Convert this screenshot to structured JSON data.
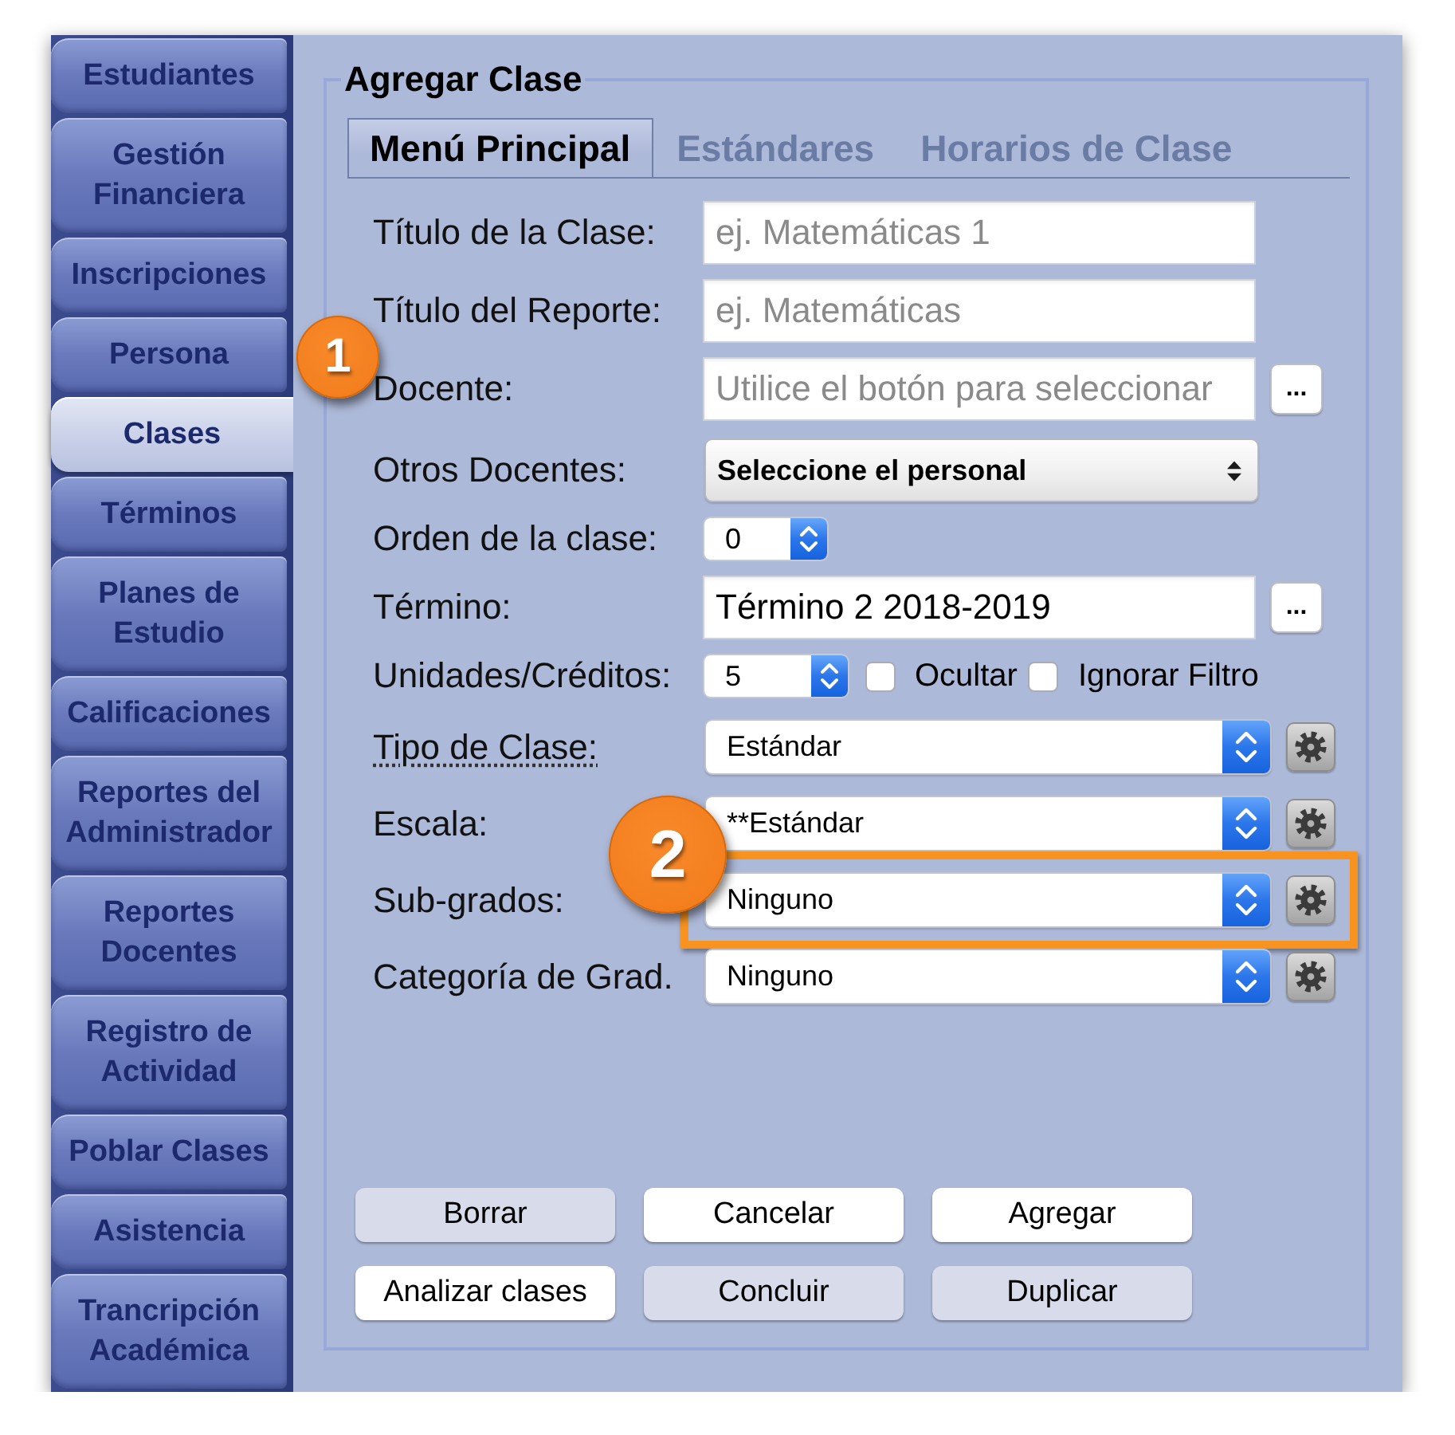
{
  "sidebar": {
    "items": [
      {
        "label": "Estudiantes",
        "selected": false
      },
      {
        "label": "Gestión Financiera",
        "selected": false
      },
      {
        "label": "Inscripciones",
        "selected": false
      },
      {
        "label": "Persona",
        "selected": false
      },
      {
        "label": "Clases",
        "selected": true
      },
      {
        "label": "Términos",
        "selected": false
      },
      {
        "label": "Planes de Estudio",
        "selected": false
      },
      {
        "label": "Calificaciones",
        "selected": false
      },
      {
        "label": "Reportes del Administrador",
        "selected": false
      },
      {
        "label": "Reportes Docentes",
        "selected": false
      },
      {
        "label": "Registro de Actividad",
        "selected": false
      },
      {
        "label": "Poblar Clases",
        "selected": false
      },
      {
        "label": "Asistencia",
        "selected": false
      },
      {
        "label": "Trancripción Académica",
        "selected": false
      }
    ]
  },
  "panel": {
    "title": "Agregar Clase"
  },
  "tabs": [
    {
      "label": "Menú Principal",
      "selected": true
    },
    {
      "label": "Estándares",
      "selected": false
    },
    {
      "label": "Horarios de Clase",
      "selected": false
    }
  ],
  "fields": [
    {
      "kind": "text",
      "label": "Título de la Clase:",
      "placeholder": "ej. Matemáticas 1",
      "linked": false,
      "highlighted": false
    },
    {
      "kind": "text",
      "label": "Título del Reporte:",
      "placeholder": "ej. Matemáticas",
      "linked": false,
      "highlighted": false
    },
    {
      "kind": "picker",
      "label": "Docente:",
      "placeholder": "Utilice el botón para seleccionar",
      "button": "...",
      "linked": false,
      "highlighted": false
    },
    {
      "kind": "popup",
      "label": "Otros Docentes:",
      "value": "Seleccione el personal",
      "linked": false,
      "highlighted": false
    },
    {
      "kind": "stepper",
      "label": "Orden de la clase:",
      "value": "0",
      "linked": false,
      "highlighted": false
    },
    {
      "kind": "picker",
      "label": "Término:",
      "value": "Término 2 2018-2019",
      "button": "...",
      "linked": false,
      "highlighted": false
    },
    {
      "kind": "stepper",
      "label": "Unidades/Créditos:",
      "value": "5",
      "checkboxes": [
        {
          "label": "Ocultar",
          "checked": false
        },
        {
          "label": "Ignorar Filtro",
          "checked": false
        }
      ],
      "linked": false,
      "highlighted": false
    },
    {
      "kind": "select",
      "label": "Tipo de Clase:",
      "value": "Estándar",
      "linked": true,
      "highlighted": false
    },
    {
      "kind": "select",
      "label": "Escala:",
      "value": "**Estándar",
      "linked": false,
      "highlighted": false
    },
    {
      "kind": "select",
      "label": "Sub-grados:",
      "value": "Ninguno",
      "linked": false,
      "highlighted": true
    },
    {
      "kind": "select",
      "label": "Categoría de Grad.",
      "value": "Ninguno",
      "linked": false,
      "highlighted": false
    }
  ],
  "buttons": [
    {
      "label": "Borrar",
      "disabled": true
    },
    {
      "label": "Cancelar",
      "disabled": false
    },
    {
      "label": "Agregar",
      "disabled": false
    },
    {
      "label": "Analizar clases",
      "disabled": false
    },
    {
      "label": "Concluir",
      "disabled": true
    },
    {
      "label": "Duplicar",
      "disabled": true
    }
  ],
  "annotations": [
    {
      "label": "1"
    },
    {
      "label": "2"
    }
  ]
}
